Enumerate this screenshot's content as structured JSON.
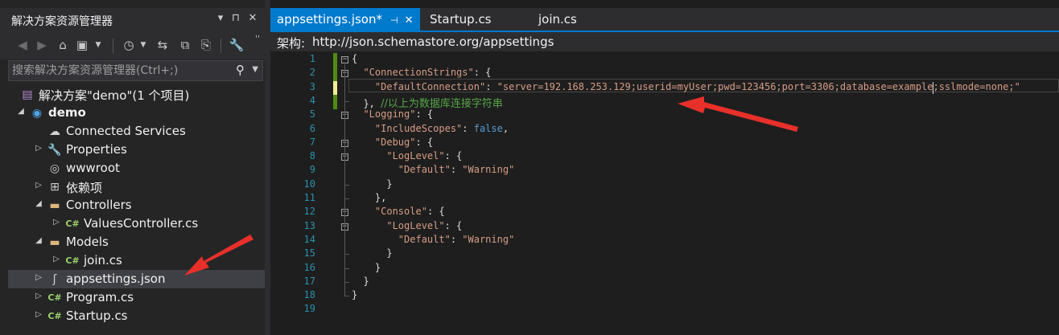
{
  "solution_explorer": {
    "title": "解决方案资源管理器",
    "title_buttons": {
      "dropdown": "▾",
      "pin": "⊓",
      "close": "✕"
    },
    "search_placeholder": "搜索解决方案资源管理器(Ctrl+;)",
    "tree": [
      {
        "label": "解决方案\"demo\"(1 个项目)",
        "icon": "solution-icon",
        "depth": 0,
        "expander": ""
      },
      {
        "label": "demo",
        "icon": "web-project-icon",
        "depth": 0,
        "expander": "expanded",
        "bold": true
      },
      {
        "label": "Connected Services",
        "icon": "connected-services-icon",
        "depth": 1,
        "expander": ""
      },
      {
        "label": "Properties",
        "icon": "wrench-icon",
        "depth": 1,
        "expander": "collapsed"
      },
      {
        "label": "wwwroot",
        "icon": "globe-icon",
        "depth": 1,
        "expander": ""
      },
      {
        "label": "依赖项",
        "icon": "dependencies-icon",
        "depth": 1,
        "expander": "collapsed"
      },
      {
        "label": "Controllers",
        "icon": "folder-icon",
        "depth": 1,
        "expander": "expanded"
      },
      {
        "label": "ValuesController.cs",
        "icon": "csharp-file-icon",
        "depth": 2,
        "expander": "collapsed"
      },
      {
        "label": "Models",
        "icon": "folder-icon",
        "depth": 1,
        "expander": "expanded"
      },
      {
        "label": "join.cs",
        "icon": "csharp-file-icon",
        "depth": 2,
        "expander": "collapsed"
      },
      {
        "label": "appsettings.json",
        "icon": "json-file-icon",
        "depth": 1,
        "expander": "collapsed",
        "selected": true
      },
      {
        "label": "Program.cs",
        "icon": "csharp-file-icon",
        "depth": 1,
        "expander": "collapsed"
      },
      {
        "label": "Startup.cs",
        "icon": "csharp-file-icon",
        "depth": 1,
        "expander": "collapsed"
      }
    ]
  },
  "editor": {
    "tabs": [
      {
        "label": "appsettings.json*",
        "active": true
      },
      {
        "label": "Startup.cs",
        "active": false
      },
      {
        "label": "join.cs",
        "active": false
      }
    ],
    "schema_label": "架构:",
    "schema_url": "http://json.schemastore.org/appsettings",
    "line_numbers": [
      "1",
      "2",
      "3",
      "4",
      "5",
      "6",
      "7",
      "8",
      "9",
      "10",
      "11",
      "12",
      "13",
      "14",
      "15",
      "16",
      "17",
      "18",
      "19"
    ],
    "lines": [
      [
        [
          "p",
          "{"
        ]
      ],
      [
        [
          "p",
          "  "
        ],
        [
          "k",
          "\"ConnectionStrings\""
        ],
        [
          "p",
          ": {"
        ]
      ],
      [
        [
          "p",
          "    "
        ],
        [
          "k",
          "\"DefaultConnection\""
        ],
        [
          "p",
          ": "
        ],
        [
          "s",
          "\"server=192.168.253.129;userid=myUser;pwd=123456;port=3306;database=example;sslmode=none;\""
        ]
      ],
      [
        [
          "p",
          "  }, "
        ],
        [
          "c",
          "//以上为数据库连接字符串"
        ]
      ],
      [
        [
          "p",
          "  "
        ],
        [
          "k",
          "\"Logging\""
        ],
        [
          "p",
          ": {"
        ]
      ],
      [
        [
          "p",
          "    "
        ],
        [
          "k",
          "\"IncludeScopes\""
        ],
        [
          "p",
          ": "
        ],
        [
          "b",
          "false"
        ],
        [
          "p",
          ","
        ]
      ],
      [
        [
          "p",
          "    "
        ],
        [
          "k",
          "\"Debug\""
        ],
        [
          "p",
          ": {"
        ]
      ],
      [
        [
          "p",
          "      "
        ],
        [
          "k",
          "\"LogLevel\""
        ],
        [
          "p",
          ": {"
        ]
      ],
      [
        [
          "p",
          "        "
        ],
        [
          "k",
          "\"Default\""
        ],
        [
          "p",
          ": "
        ],
        [
          "s",
          "\"Warning\""
        ]
      ],
      [
        [
          "p",
          "      }"
        ]
      ],
      [
        [
          "p",
          "    },"
        ]
      ],
      [
        [
          "p",
          "    "
        ],
        [
          "k",
          "\"Console\""
        ],
        [
          "p",
          ": {"
        ]
      ],
      [
        [
          "p",
          "      "
        ],
        [
          "k",
          "\"LogLevel\""
        ],
        [
          "p",
          ": {"
        ]
      ],
      [
        [
          "p",
          "        "
        ],
        [
          "k",
          "\"Default\""
        ],
        [
          "p",
          ": "
        ],
        [
          "s",
          "\"Warning\""
        ]
      ],
      [
        [
          "p",
          "      }"
        ]
      ],
      [
        [
          "p",
          "    }"
        ]
      ],
      [
        [
          "p",
          "  }"
        ]
      ],
      [
        [
          "p",
          "}"
        ]
      ],
      [
        [
          "p",
          ""
        ]
      ]
    ]
  },
  "colors": {
    "accent": "#007acc",
    "annotation_arrow": "#e8302a"
  }
}
